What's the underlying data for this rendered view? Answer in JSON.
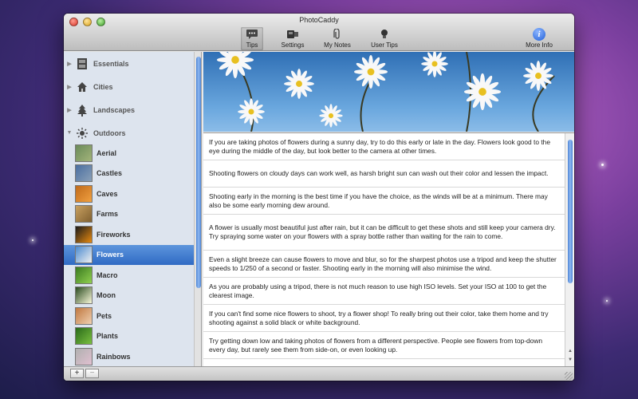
{
  "window": {
    "title": "PhotoCaddy"
  },
  "toolbar": {
    "items": [
      {
        "label": "Tips",
        "icon": "speech-bubble-icon",
        "selected": true
      },
      {
        "label": "Settings",
        "icon": "camera-icon"
      },
      {
        "label": "My Notes",
        "icon": "paperclip-icon"
      },
      {
        "label": "User Tips",
        "icon": "lightbulb-icon"
      }
    ],
    "more_info": {
      "label": "More Info",
      "icon": "info-icon",
      "glyph": "i"
    }
  },
  "sidebar": {
    "groups": [
      {
        "label": "Essentials",
        "icon": "film-icon",
        "expanded": false
      },
      {
        "label": "Cities",
        "icon": "house-icon",
        "expanded": false
      },
      {
        "label": "Landscapes",
        "icon": "tree-icon",
        "expanded": false
      },
      {
        "label": "Outdoors",
        "icon": "sun-icon",
        "expanded": true
      }
    ],
    "children": [
      {
        "label": "Aerial",
        "colors": [
          "#6a8a5a",
          "#a3b47a"
        ]
      },
      {
        "label": "Castles",
        "colors": [
          "#4a6ea0",
          "#8aa0b8"
        ]
      },
      {
        "label": "Caves",
        "colors": [
          "#c06a1a",
          "#f0a040"
        ]
      },
      {
        "label": "Farms",
        "colors": [
          "#c8a060",
          "#806030"
        ]
      },
      {
        "label": "Fireworks",
        "colors": [
          "#1a1a1a",
          "#e88a10"
        ]
      },
      {
        "label": "Flowers",
        "colors": [
          "#4a8ad0",
          "#f0f0f0"
        ],
        "selected": true
      },
      {
        "label": "Macro",
        "colors": [
          "#3a7a20",
          "#90d050"
        ]
      },
      {
        "label": "Moon",
        "colors": [
          "#2a4a20",
          "#f8f8d8"
        ]
      },
      {
        "label": "Pets",
        "colors": [
          "#c07840",
          "#f0d0b0"
        ]
      },
      {
        "label": "Plants",
        "colors": [
          "#2a6a1a",
          "#7ac040"
        ]
      },
      {
        "label": "Rainbows",
        "colors": [
          "#b0b0b0",
          "#e0c0d0"
        ]
      }
    ]
  },
  "bottom": {
    "add_glyph": "+",
    "remove_glyph": "−"
  },
  "tips": [
    "If you are taking photos of flowers during a sunny day, try to do this early or late in the day. Flowers look good to the eye during the middle of the day, but look better to the camera at other times.",
    "Shooting flowers on cloudy days can work well, as harsh bright sun can wash out their color and lessen the impact.",
    "Shooting early in the morning is the best time if you have the choice, as the winds will be at a minimum. There may also be some early morning dew around.",
    "A flower is usually most beautiful just after rain, but it can be difficult to get these shots and still keep your camera dry. Try spraying some water on your flowers with a spray bottle rather than waiting for the rain to come.",
    "Even a slight breeze can cause flowers to move and blur, so for the sharpest photos use a tripod and keep the shutter speeds to 1/250 of a second or faster. Shooting early in the morning will also minimise the wind.",
    "As you are probably using a tripod, there is not much reason to use high ISO levels. Set your ISO at 100 to get the clearest image.",
    "If you can't find some nice flowers to shoot, try a flower shop! To really bring out their color, take them home and try shooting against a solid black or white background.",
    "Try getting down low and taking photos of flowers from a different perspective. People see flowers from top-down every day, but rarely see them from side-on, or even looking up."
  ]
}
